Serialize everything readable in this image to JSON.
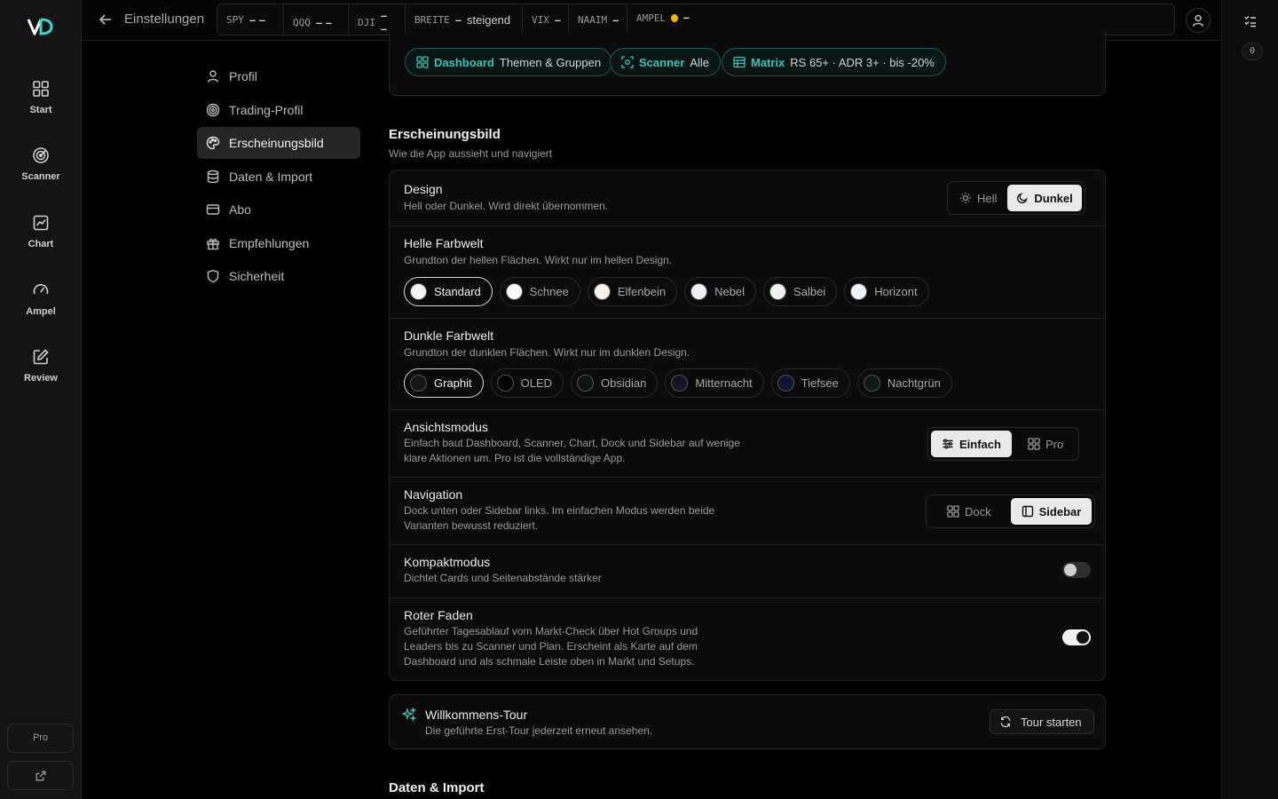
{
  "rail": {
    "items": [
      {
        "label": "Start",
        "icon": "grid-icon"
      },
      {
        "label": "Scanner",
        "icon": "radar-icon"
      },
      {
        "label": "Chart",
        "icon": "chart-icon"
      },
      {
        "label": "Ampel",
        "icon": "gauge-icon"
      },
      {
        "label": "Review",
        "icon": "edit-icon"
      }
    ],
    "pro_label": "Pro"
  },
  "header": {
    "title": "Einstellungen",
    "ticker": [
      {
        "key": "SPY",
        "value": "– –"
      },
      {
        "key": "QQQ",
        "value": "– –"
      },
      {
        "key": "DJI",
        "value": "– –"
      },
      {
        "key": "BREITE",
        "value": "steigend",
        "prefix": "–"
      },
      {
        "key": "VIX",
        "value": "–"
      },
      {
        "key": "NAAIM",
        "value": "–"
      },
      {
        "key": "AMPEL",
        "value": "–",
        "dot_color": "#f5b301"
      }
    ]
  },
  "right_rail": {
    "badge": "0"
  },
  "settings_nav": [
    {
      "label": "Profil",
      "icon": "user-icon"
    },
    {
      "label": "Trading-Profil",
      "icon": "target-icon"
    },
    {
      "label": "Erscheinungsbild",
      "icon": "palette-icon",
      "active": true
    },
    {
      "label": "Daten & Import",
      "icon": "database-icon"
    },
    {
      "label": "Abo",
      "icon": "credit-card-icon"
    },
    {
      "label": "Empfehlungen",
      "icon": "gift-icon"
    },
    {
      "label": "Sicherheit",
      "icon": "shield-icon"
    }
  ],
  "chips": [
    {
      "bold": "Dashboard",
      "text": "Themen & Gruppen",
      "icon": "dashboard-icon"
    },
    {
      "bold": "Scanner",
      "text": "Alle",
      "icon": "scan-icon"
    },
    {
      "bold": "Matrix",
      "text": "RS 65+ · ADR 3+ · bis -20%",
      "icon": "table-icon"
    }
  ],
  "appearance": {
    "title": "Erscheinungsbild",
    "subtitle": "Wie die App aussieht und navigiert",
    "design": {
      "title": "Design",
      "desc": "Hell oder Dunkel. Wird direkt übernommen.",
      "options": [
        "Hell",
        "Dunkel"
      ],
      "selected": "Dunkel"
    },
    "light_theme": {
      "title": "Helle Farbwelt",
      "desc": "Grundton der hellen Flächen. Wirkt nur im hellen Design.",
      "options": [
        {
          "label": "Standard",
          "color": "#f4f4f4"
        },
        {
          "label": "Schnee",
          "color": "#fafafa"
        },
        {
          "label": "Elfenbein",
          "color": "#f6f2e8"
        },
        {
          "label": "Nebel",
          "color": "#eef0f4"
        },
        {
          "label": "Salbei",
          "color": "#eef3ee"
        },
        {
          "label": "Horizont",
          "color": "#f0f3f8"
        }
      ],
      "selected": "Standard"
    },
    "dark_theme": {
      "title": "Dunkle Farbwelt",
      "desc": "Grundton der dunklen Flächen. Wirkt nur im dunklen Design.",
      "options": [
        {
          "label": "Graphit",
          "color": "#141414"
        },
        {
          "label": "OLED",
          "color": "#000000"
        },
        {
          "label": "Obsidian",
          "color": "#0d1418"
        },
        {
          "label": "Mitternacht",
          "color": "#111526"
        },
        {
          "label": "Tiefsee",
          "color": "#0c1630"
        },
        {
          "label": "Nachtgrün",
          "color": "#0d1a16"
        }
      ],
      "selected": "Graphit"
    },
    "view_mode": {
      "title": "Ansichtsmodus",
      "desc": "Einfach baut Dashboard, Scanner, Chart, Dock und Sidebar auf wenige klare Aktionen um. Pro ist die vollständige App.",
      "options": [
        "Einfach",
        "Pro"
      ],
      "selected": "Einfach"
    },
    "navigation": {
      "title": "Navigation",
      "desc": "Dock unten oder Sidebar links. Im einfachen Modus werden beide Varianten bewusst reduziert.",
      "options": [
        "Dock",
        "Sidebar"
      ],
      "selected": "Sidebar"
    },
    "compact": {
      "title": "Kompaktmodus",
      "desc": "Dichtet Cards und Seitenabstände stärker",
      "enabled": false
    },
    "red_thread": {
      "title": "Roter Faden",
      "desc": "Geführter Tagesablauf vom Markt-Check über Hot Groups und Leaders bis zu Scanner und Plan. Erscheint als Karte auf dem Dashboard und als schmale Leiste oben in Markt und Setups.",
      "enabled": true
    }
  },
  "tour": {
    "title": "Willkommens-Tour",
    "desc": "Die geführte Erst-Tour jederzeit erneut ansehen.",
    "button": "Tour starten"
  },
  "next_section": {
    "title": "Daten & Import"
  }
}
